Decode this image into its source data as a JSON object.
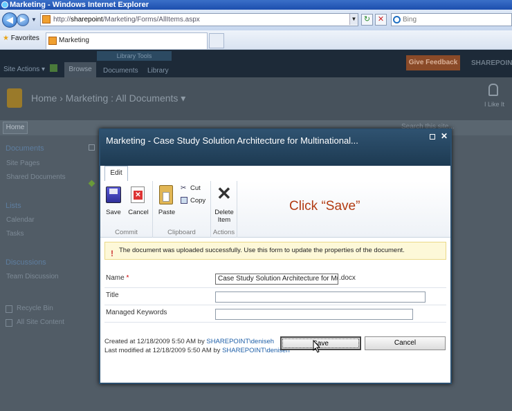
{
  "browser": {
    "title": "Marketing - Windows Internet Explorer",
    "url_prefix": "http://",
    "url_host": "sharepoint",
    "url_path": "/Marketing/Forms/AllItems.aspx",
    "search_placeholder": "Bing",
    "favorites_label": "Favorites",
    "tab_title": "Marketing"
  },
  "sharepoint": {
    "site_actions": "Site Actions",
    "ribbon_context_group": "Library Tools",
    "tabs": [
      "Browse",
      "Documents",
      "Library"
    ],
    "feedback": "Give Feedback",
    "brand": "SHAREPOINT",
    "breadcrumb": "Home › Marketing : All Documents ▾",
    "like": "I Like It",
    "home_tab": "Home",
    "search_placeholder": "Search this site...",
    "quicklaunch": {
      "documents_heading": "Documents",
      "documents": [
        "Site Pages",
        "Shared Documents"
      ],
      "lists_heading": "Lists",
      "lists": [
        "Calendar",
        "Tasks"
      ],
      "discussions_heading": "Discussions",
      "discussions": [
        "Team Discussion"
      ],
      "recycle_bin": "Recycle Bin",
      "all_site_content": "All Site Content"
    }
  },
  "dialog": {
    "title": "Marketing - Case Study Solution Architecture for Multinational...",
    "edit_tab": "Edit",
    "ribbon": {
      "save": "Save",
      "cancel": "Cancel",
      "commit_group": "Commit",
      "paste": "Paste",
      "cut": "Cut",
      "copy": "Copy",
      "clipboard_group": "Clipboard",
      "delete_item": "Delete\nItem",
      "actions_group": "Actions"
    },
    "annotation": "Click “Save”",
    "message": "The document was uploaded successfully. Use this form to update the properties of the document.",
    "fields": {
      "name_label": "Name",
      "required_mark": "*",
      "name_value": "Case Study Solution Architecture for Mu",
      "name_ext": ".docx",
      "title_label": "Title",
      "title_value": "",
      "keywords_label": "Managed Keywords",
      "keywords_value": ""
    },
    "meta": {
      "created_prefix": "Created at 12/18/2009 5:50 AM  by ",
      "created_by": "SHAREPOINT\\deniseh",
      "modified_prefix": "Last modified at 12/18/2009 5:50 AM  by ",
      "modified_by": "SHAREPOINT\\deniseh"
    },
    "save_button": "Save",
    "cancel_button": "Cancel"
  }
}
